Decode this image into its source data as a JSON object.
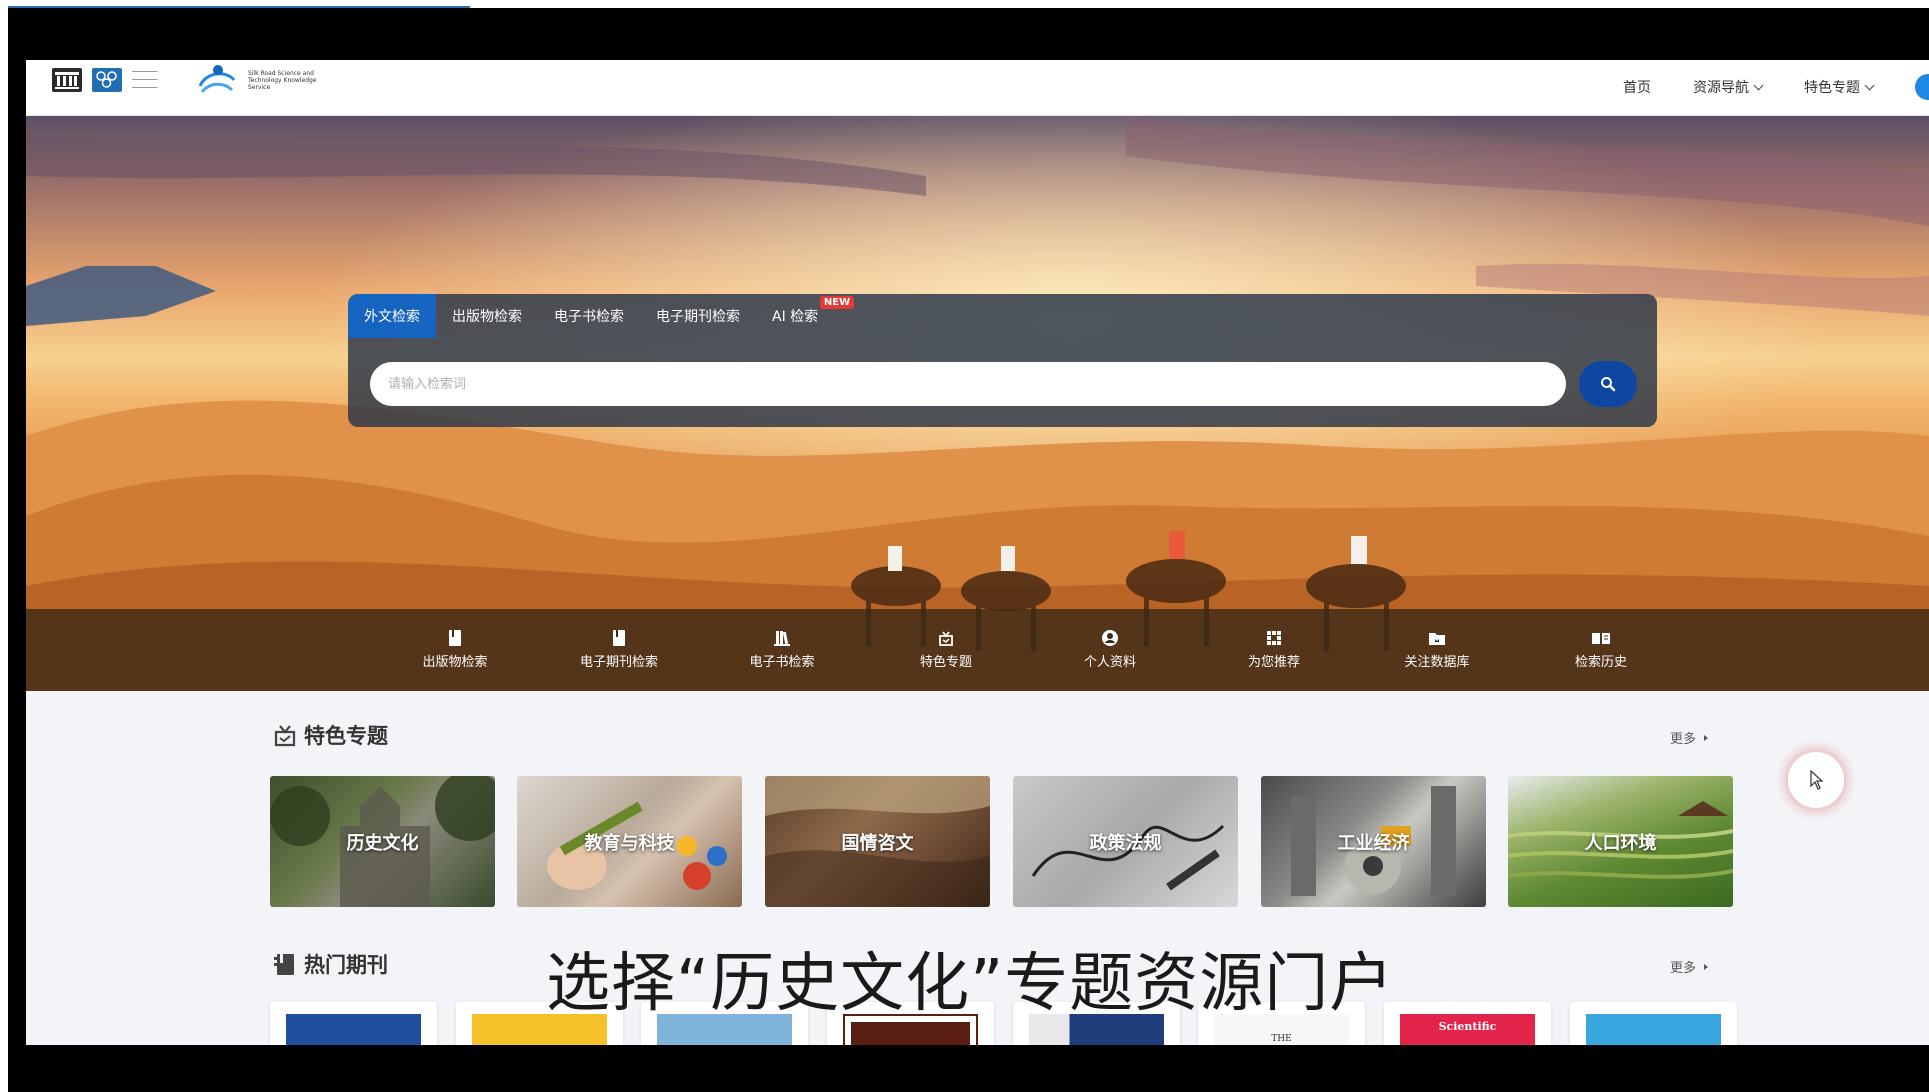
{
  "header": {
    "logo_text_left": "Silk Road Science and Technology Knowledge Service",
    "nav": [
      {
        "label": "首页"
      },
      {
        "label": "资源导航"
      },
      {
        "label": "特色专题"
      }
    ]
  },
  "search": {
    "tabs": [
      {
        "label": "外文检索"
      },
      {
        "label": "出版物检索"
      },
      {
        "label": "电子书检索"
      },
      {
        "label": "电子期刊检索"
      },
      {
        "label": "AI 检索"
      }
    ],
    "ai_badge": "NEW",
    "placeholder": "请输入检索词"
  },
  "quickbar": [
    {
      "label": "出版物检索",
      "icon": "book-icon"
    },
    {
      "label": "电子期刊检索",
      "icon": "journal-icon"
    },
    {
      "label": "电子书检索",
      "icon": "library-icon"
    },
    {
      "label": "特色专题",
      "icon": "gift-box-icon"
    },
    {
      "label": "个人资料",
      "icon": "user-circle-icon"
    },
    {
      "label": "为您推荐",
      "icon": "grid-icon"
    },
    {
      "label": "关注数据库",
      "icon": "folder-icon"
    },
    {
      "label": "检索历史",
      "icon": "open-book-icon"
    }
  ],
  "featured": {
    "title": "特色专题",
    "more": "更多",
    "topics": [
      {
        "label": "历史文化"
      },
      {
        "label": "教育与科技"
      },
      {
        "label": "国情咨文"
      },
      {
        "label": "政策法规"
      },
      {
        "label": "工业经济"
      },
      {
        "label": "人口环境"
      }
    ]
  },
  "journals": {
    "title": "热门期刊",
    "more": "更多",
    "covers": [
      {
        "color": "#1f4e9c"
      },
      {
        "color": "#f5c12a"
      },
      {
        "color": "#7fb3d9"
      },
      {
        "color": "#5a1e12"
      },
      {
        "color": "#1f3d7a"
      },
      {
        "color": "#f3f3f3",
        "text": "THE"
      },
      {
        "color": "#e3244a",
        "text": "Scientific"
      },
      {
        "color": "#3aa6e0"
      }
    ]
  },
  "caption": "选择“历史文化”专题资源门户",
  "colors": {
    "accent": "#1565c0",
    "search_button": "#0d47a1",
    "badge": "#e53935"
  }
}
